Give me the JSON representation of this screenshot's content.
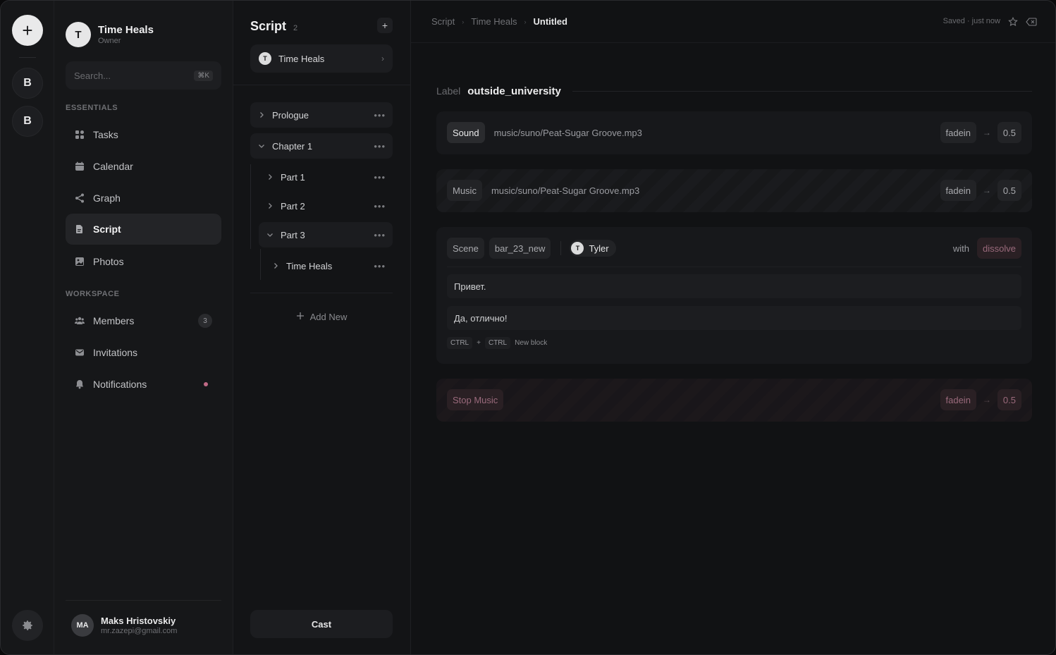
{
  "rail": {
    "add_label": "+",
    "workspaces": [
      "B",
      "B"
    ]
  },
  "workspace": {
    "initial": "T",
    "name": "Time Heals",
    "role": "Owner"
  },
  "search": {
    "placeholder": "Search...",
    "shortcut": "⌘K"
  },
  "sections": {
    "essentials": "ESSENTIALS",
    "workspace": "WORKSPACE"
  },
  "nav": {
    "tasks": "Tasks",
    "calendar": "Calendar",
    "graph": "Graph",
    "script": "Script",
    "photos": "Photos",
    "members": "Members",
    "members_count": "3",
    "invitations": "Invitations",
    "notifications": "Notifications"
  },
  "user": {
    "initials": "MA",
    "name": "Maks Hristovskiy",
    "email": "mr.zazepi@gmail.com"
  },
  "tree": {
    "title": "Script",
    "count": "2",
    "add": "+",
    "project": {
      "initial": "T",
      "name": "Time Heals"
    },
    "nodes": {
      "prologue": "Prologue",
      "chapter1": "Chapter 1",
      "part1": "Part 1",
      "part2": "Part 2",
      "part3": "Part 3",
      "timeheals": "Time Heals"
    },
    "more": "•••",
    "add_new": "Add New",
    "cast": "Cast"
  },
  "breadcrumb": {
    "a": "Script",
    "b": "Time Heals",
    "current": "Untitled"
  },
  "status": {
    "saved": "Saved · just now"
  },
  "label": {
    "key": "Label",
    "value": "outside_university"
  },
  "sound": {
    "type": "Sound",
    "path": "music/suno/Peat-Sugar Groove.mp3",
    "effect": "fadein",
    "value": "0.5"
  },
  "music": {
    "type": "Music",
    "path": "music/suno/Peat-Sugar Groove.mp3",
    "effect": "fadein",
    "value": "0.5"
  },
  "scene": {
    "type": "Scene",
    "name": "bar_23_new",
    "character_initial": "T",
    "character": "Tyler",
    "with": "with",
    "transition": "dissolve",
    "lines": [
      "Привет.",
      "Да, отлично!"
    ],
    "hint_key1": "CTRL",
    "hint_plus": "+",
    "hint_key2": "CTRL",
    "hint_text": "New block"
  },
  "stop": {
    "type": "Stop Music",
    "effect": "fadein",
    "value": "0.5"
  },
  "colors": {
    "accent_pink": "#c06a86",
    "background": "#111214"
  }
}
